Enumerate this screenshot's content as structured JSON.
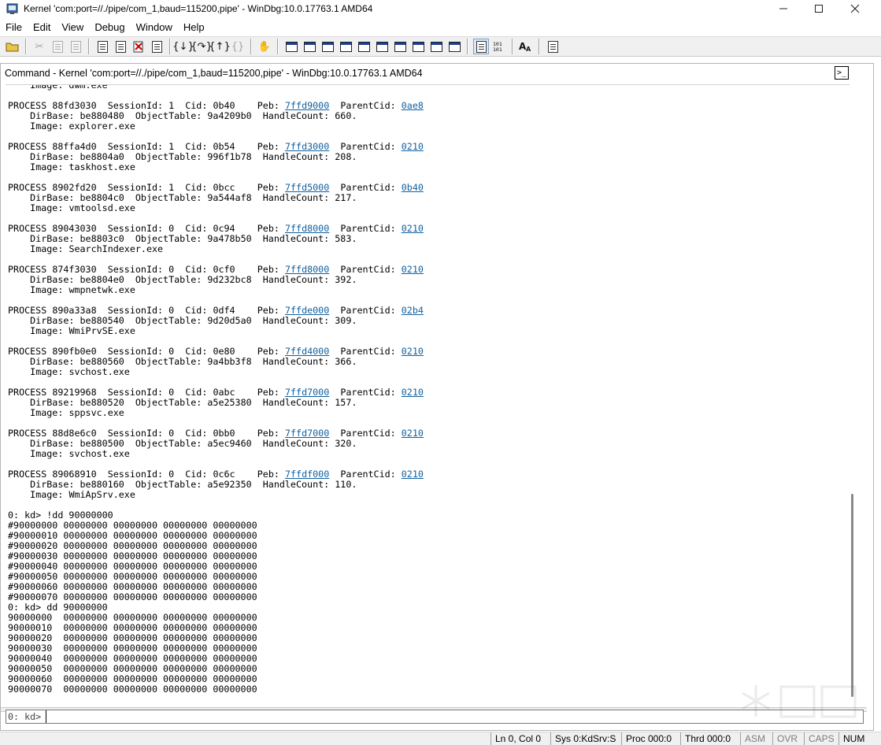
{
  "window": {
    "title": "Kernel 'com:port=//./pipe/com_1,baud=115200,pipe' - WinDbg:10.0.17763.1 AMD64",
    "controls": [
      "minimize-icon",
      "maximize-icon",
      "close-icon"
    ]
  },
  "menu": {
    "items": [
      "File",
      "Edit",
      "View",
      "Debug",
      "Window",
      "Help"
    ]
  },
  "toolbar": {
    "icons": [
      "open-icon",
      "cut-icon",
      "copy-icon",
      "paste-icon",
      "go-icon",
      "restart-icon",
      "stop-debugging-icon",
      "break-icon",
      "step-into-icon",
      "step-over-icon",
      "step-out-icon",
      "run-to-cursor-icon",
      "hand-icon",
      "command-window-icon",
      "watch-window-icon",
      "locals-window-icon",
      "registers-window-icon",
      "memory-window-icon",
      "call-stack-icon",
      "disassembly-icon",
      "scratch-pad-icon",
      "processes-threads-icon",
      "source-mode-icon",
      "hex-mode-icon",
      "font-icon",
      "options-icon"
    ]
  },
  "command_window": {
    "title": "Command - Kernel 'com:port=//./pipe/com_1,baud=115200,pipe' - WinDbg:10.0.17763.1 AMD64",
    "first_line": "    Image: dwm.exe",
    "processes": [
      {
        "process": "88fd3030",
        "session": "1",
        "cid": "0b40",
        "peb": "7ffd9000",
        "parent": "0ae8",
        "dirbase": "be880480",
        "objtable": "9a4209b0",
        "handles": "660",
        "image": "explorer.exe"
      },
      {
        "process": "88ffa4d0",
        "session": "1",
        "cid": "0b54",
        "peb": "7ffd3000",
        "parent": "0210",
        "dirbase": "be8804a0",
        "objtable": "996f1b78",
        "handles": "208",
        "image": "taskhost.exe"
      },
      {
        "process": "8902fd20",
        "session": "1",
        "cid": "0bcc",
        "peb": "7ffd5000",
        "parent": "0b40",
        "dirbase": "be8804c0",
        "objtable": "9a544af8",
        "handles": "217",
        "image": "vmtoolsd.exe"
      },
      {
        "process": "89043030",
        "session": "0",
        "cid": "0c94",
        "peb": "7ffd8000",
        "parent": "0210",
        "dirbase": "be8803c0",
        "objtable": "9a478b50",
        "handles": "583",
        "image": "SearchIndexer.exe"
      },
      {
        "process": "874f3030",
        "session": "0",
        "cid": "0cf0",
        "peb": "7ffd8000",
        "parent": "0210",
        "dirbase": "be8804e0",
        "objtable": "9d232bc8",
        "handles": "392",
        "image": "wmpnetwk.exe"
      },
      {
        "process": "890a33a8",
        "session": "0",
        "cid": "0df4",
        "peb": "7ffde000",
        "parent": "02b4",
        "dirbase": "be880540",
        "objtable": "9d20d5a0",
        "handles": "309",
        "image": "WmiPrvSE.exe"
      },
      {
        "process": "890fb0e0",
        "session": "0",
        "cid": "0e80",
        "peb": "7ffd4000",
        "parent": "0210",
        "dirbase": "be880560",
        "objtable": "9a4bb3f8",
        "handles": "366",
        "image": "svchost.exe"
      },
      {
        "process": "89219968",
        "session": "0",
        "cid": "0abc",
        "peb": "7ffd7000",
        "parent": "0210",
        "dirbase": "be880520",
        "objtable": "a5e25380",
        "handles": "157",
        "image": "sppsvc.exe"
      },
      {
        "process": "88d8e6c0",
        "session": "0",
        "cid": "0bb0",
        "peb": "7ffd7000",
        "parent": "0210",
        "dirbase": "be880500",
        "objtable": "a5ec9460",
        "handles": "320",
        "image": "svchost.exe"
      },
      {
        "process": "89068910",
        "session": "0",
        "cid": "0c6c",
        "peb": "7ffdf000",
        "parent": "0210",
        "dirbase": "be880160",
        "objtable": "a5e92350",
        "handles": "110",
        "image": "WmiApSrv.exe"
      }
    ],
    "labels": {
      "process": "PROCESS",
      "session": "SessionId:",
      "cid": "Cid:",
      "peb": "Peb:",
      "parent": "ParentCid:",
      "dirbase": "DirBase:",
      "objtable": "ObjectTable:",
      "handles": "HandleCount:",
      "image": "Image:"
    },
    "commands": [
      {
        "line": "0: kd> !dd 90000000",
        "rows": [
          "#90000000 00000000 00000000 00000000 00000000",
          "#90000010 00000000 00000000 00000000 00000000",
          "#90000020 00000000 00000000 00000000 00000000",
          "#90000030 00000000 00000000 00000000 00000000",
          "#90000040 00000000 00000000 00000000 00000000",
          "#90000050 00000000 00000000 00000000 00000000",
          "#90000060 00000000 00000000 00000000 00000000",
          "#90000070 00000000 00000000 00000000 00000000"
        ]
      },
      {
        "line": "0: kd> dd 90000000",
        "rows": [
          "90000000  00000000 00000000 00000000 00000000",
          "90000010  00000000 00000000 00000000 00000000",
          "90000020  00000000 00000000 00000000 00000000",
          "90000030  00000000 00000000 00000000 00000000",
          "90000040  00000000 00000000 00000000 00000000",
          "90000050  00000000 00000000 00000000 00000000",
          "90000060  00000000 00000000 00000000 00000000",
          "90000070  00000000 00000000 00000000 00000000"
        ]
      }
    ],
    "prompt": "0: kd>",
    "input_value": ""
  },
  "status_bar": {
    "position": "Ln 0, Col 0",
    "system": "Sys 0:KdSrv:S",
    "process": "Proc 000:0",
    "thread": "Thrd 000:0",
    "asm": "ASM",
    "ovr": "OVR",
    "caps": "CAPS",
    "num": "NUM"
  },
  "colors": {
    "link": "#1060a0",
    "toolbar_bg": "#f0f0f0",
    "text": "#000000"
  }
}
